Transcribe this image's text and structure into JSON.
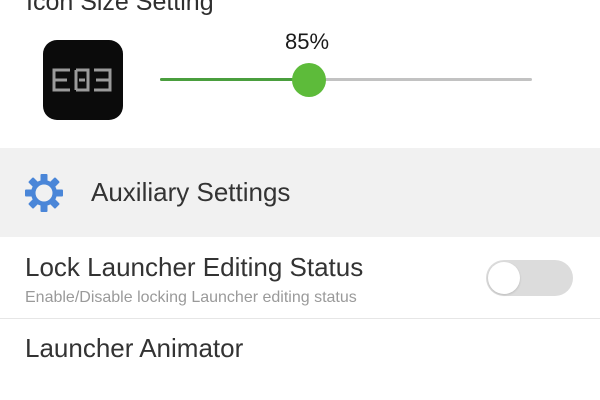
{
  "icon_size": {
    "section_title": "Icon Size Setting",
    "slider_value_label": "85%",
    "slider_fraction": 0.4,
    "preview_icon": "elephone-app-icon"
  },
  "auxiliary": {
    "header_title": "Auxiliary Settings",
    "header_icon": "gear-icon",
    "accent_color": "#4a86d8"
  },
  "settings": {
    "lock_editing": {
      "title": "Lock Launcher Editing Status",
      "subtitle": "Enable/Disable locking Launcher editing status",
      "toggle_on": false
    },
    "animator": {
      "title": "Launcher Animator"
    }
  },
  "colors": {
    "slider_active": "#4a9e3e",
    "slider_thumb": "#5dbb3a",
    "slider_inactive": "#c2c2c2",
    "header_background": "#f1f1f1",
    "toggle_off_track": "#dcdcdc"
  }
}
